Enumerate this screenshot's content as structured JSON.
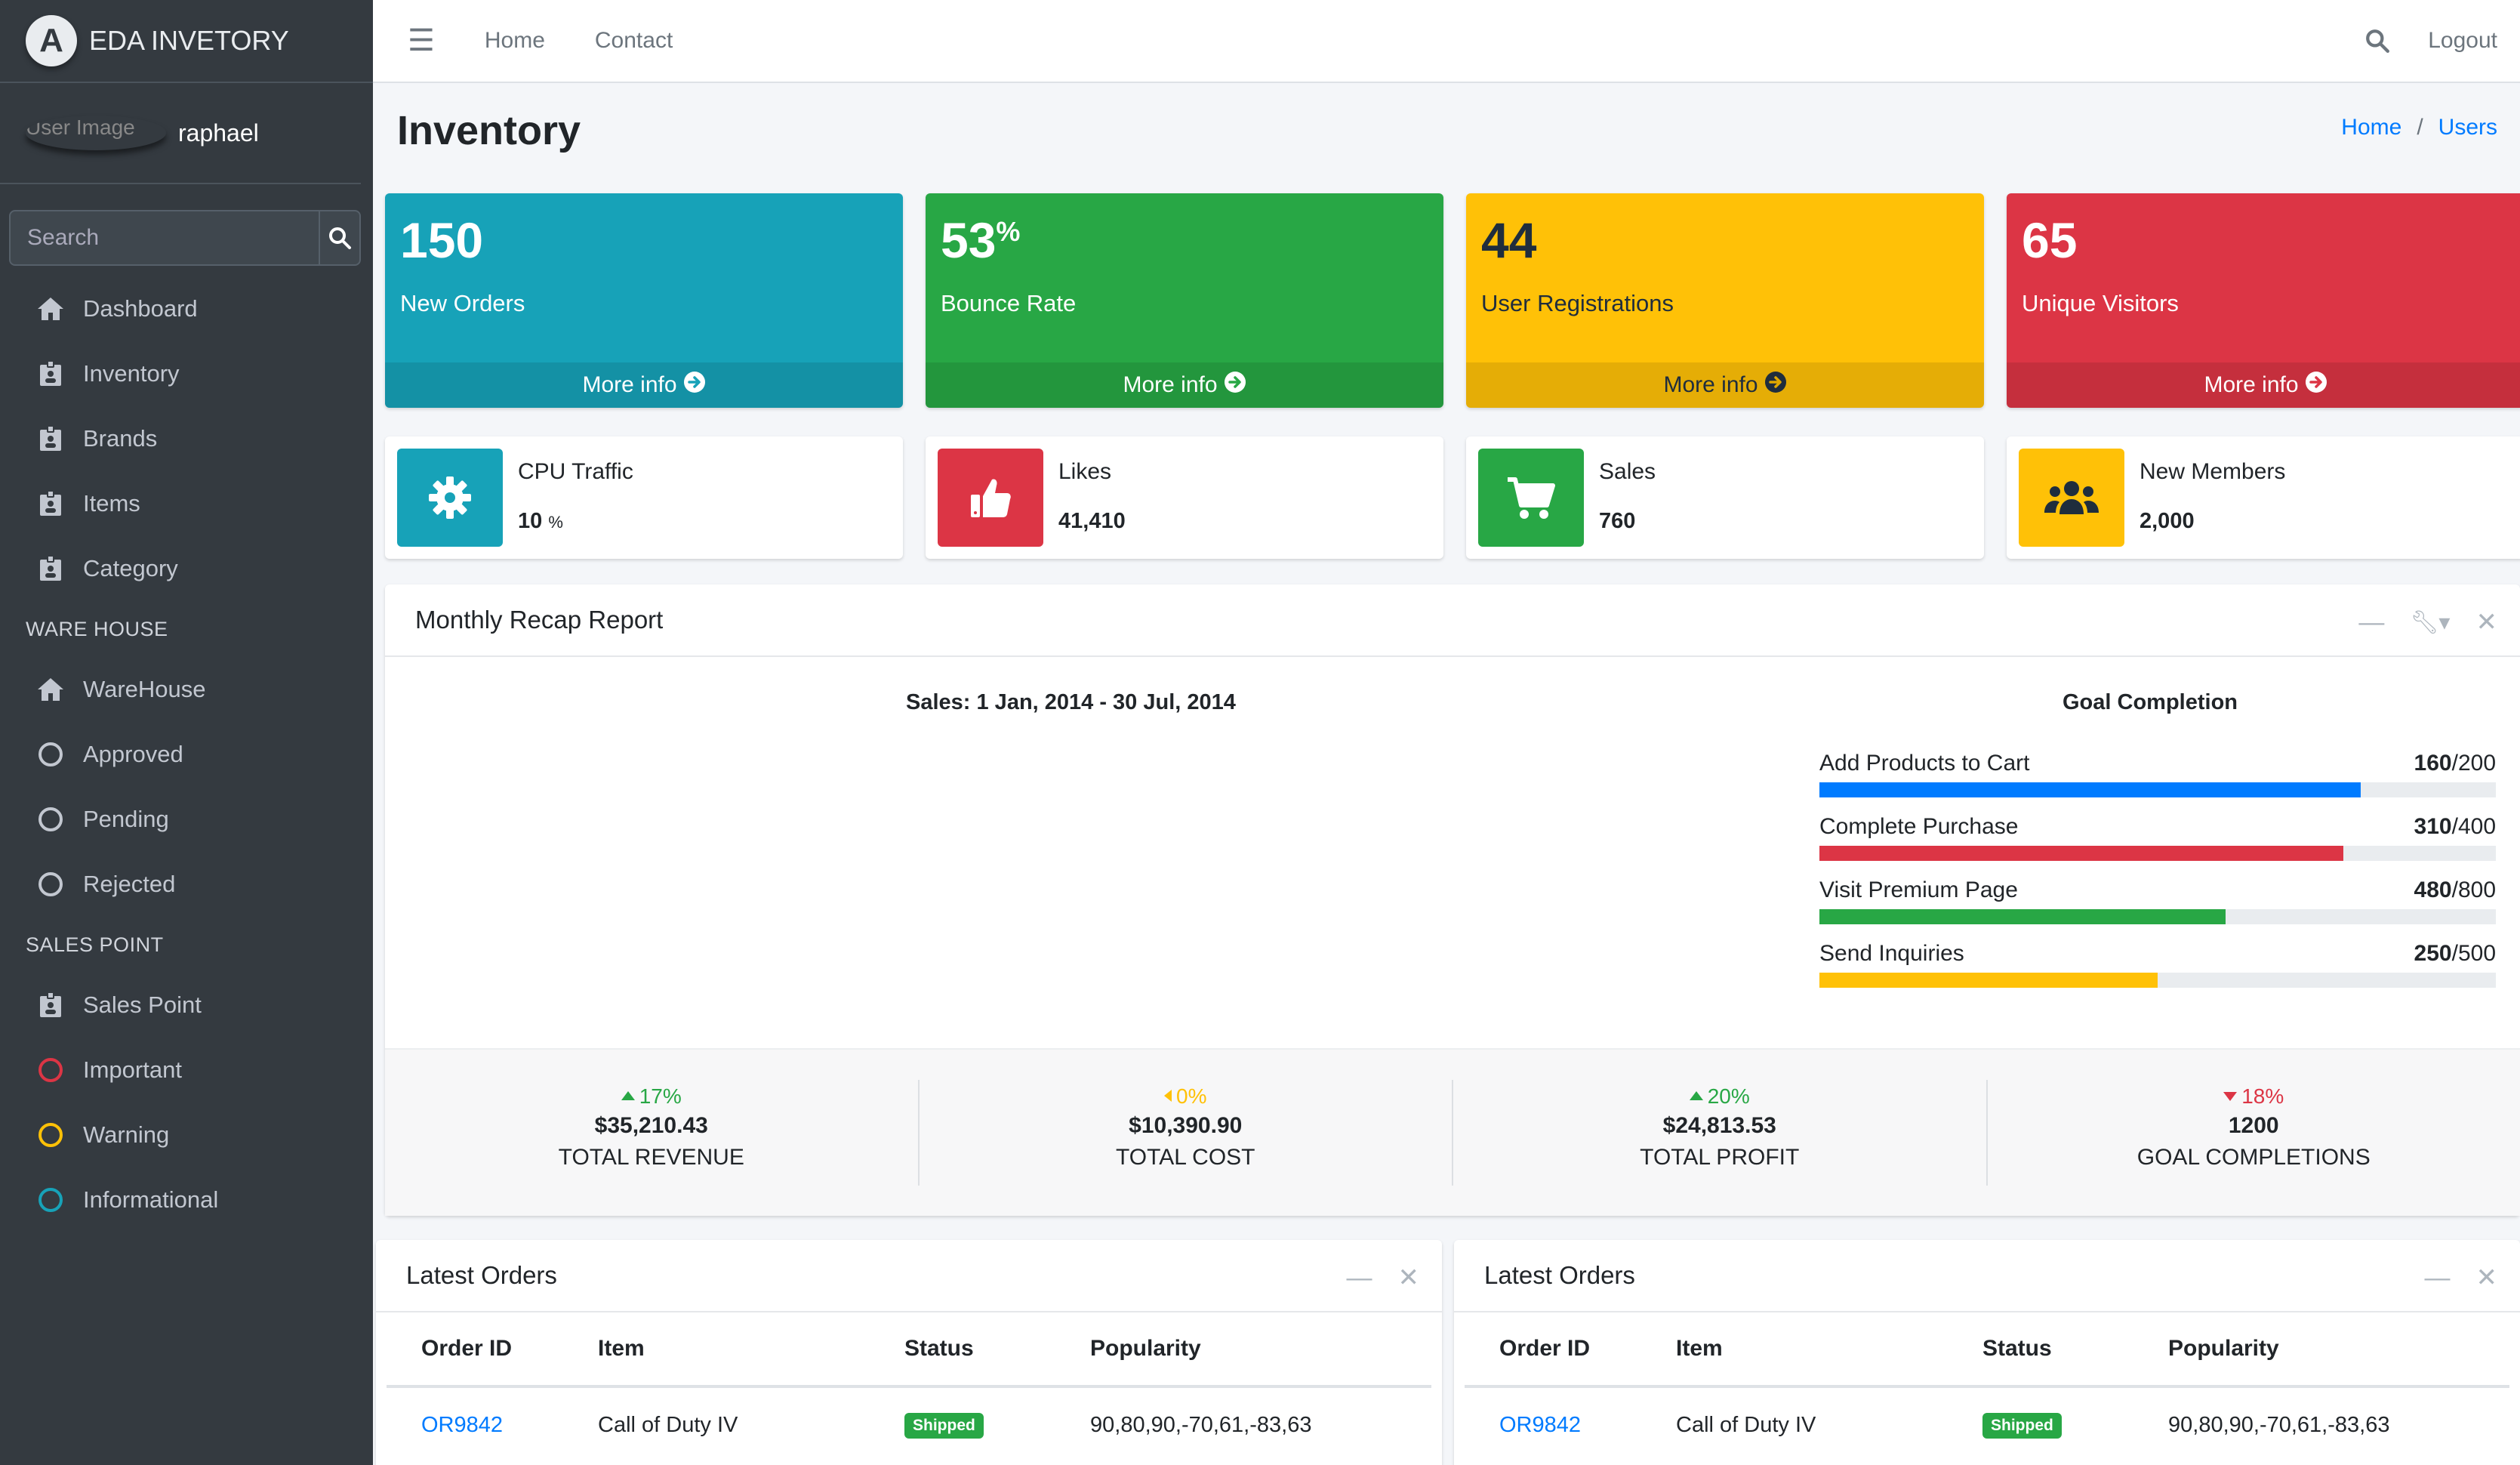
{
  "brand": {
    "name": "EDA INVETORY",
    "logo_letter": "A"
  },
  "user": {
    "image_alt": "User Image",
    "name": "raphael"
  },
  "search": {
    "placeholder": "Search"
  },
  "nav": {
    "items_main": [
      {
        "label": "Dashboard",
        "icon": "home-icon"
      },
      {
        "label": "Inventory",
        "icon": "id-badge-icon"
      },
      {
        "label": "Brands",
        "icon": "id-badge-icon"
      },
      {
        "label": "Items",
        "icon": "id-badge-icon"
      },
      {
        "label": "Category",
        "icon": "id-badge-icon"
      }
    ],
    "header_warehouse": "WARE HOUSE",
    "items_warehouse": [
      {
        "label": "WareHouse",
        "icon": "home-icon"
      },
      {
        "label": "Approved",
        "icon": "circle-icon"
      },
      {
        "label": "Pending",
        "icon": "circle-icon"
      },
      {
        "label": "Rejected",
        "icon": "circle-icon"
      }
    ],
    "header_sales": "SALES POINT",
    "items_sales": [
      {
        "label": "Sales Point",
        "icon": "id-badge-icon"
      },
      {
        "label": "Important",
        "icon": "circle-icon",
        "color": "#dc3545"
      },
      {
        "label": "Warning",
        "icon": "circle-icon",
        "color": "#ffc107"
      },
      {
        "label": "Informational",
        "icon": "circle-icon",
        "color": "#17a2b8"
      }
    ]
  },
  "topbar": {
    "home": "Home",
    "contact": "Contact",
    "logout": "Logout"
  },
  "page": {
    "title": "Inventory",
    "breadcrumb": [
      "Home",
      "Users"
    ]
  },
  "small_boxes": [
    {
      "value": "150",
      "suffix": "",
      "label": "New Orders",
      "more": "More info",
      "color": "#17a2b8"
    },
    {
      "value": "53",
      "suffix": "%",
      "label": "Bounce Rate",
      "more": "More info",
      "color": "#28a745"
    },
    {
      "value": "44",
      "suffix": "",
      "label": "User Registrations",
      "more": "More info",
      "color": "#ffc107"
    },
    {
      "value": "65",
      "suffix": "",
      "label": "Unique Visitors",
      "more": "More info",
      "color": "#dc3545"
    }
  ],
  "info_boxes": [
    {
      "title": "CPU Traffic",
      "value": "10",
      "unit": "%",
      "icon": "gear-icon",
      "color": "#17a2b8"
    },
    {
      "title": "Likes",
      "value": "41,410",
      "unit": "",
      "icon": "thumbs-up-icon",
      "color": "#dc3545"
    },
    {
      "title": "Sales",
      "value": "760",
      "unit": "",
      "icon": "shopping-cart-icon",
      "color": "#28a745"
    },
    {
      "title": "New Members",
      "value": "2,000",
      "unit": "",
      "icon": "users-icon",
      "color": "#ffc107"
    }
  ],
  "recap": {
    "title": "Monthly Recap Report",
    "sales_title": "Sales: 1 Jan, 2014 - 30 Jul, 2014",
    "goal_title": "Goal Completion",
    "goals": [
      {
        "label": "Add Products to Cart",
        "done": "160",
        "total": "/200",
        "fraction": 0.8,
        "color": "#007bff"
      },
      {
        "label": "Complete Purchase",
        "done": "310",
        "total": "/400",
        "fraction": 0.775,
        "color": "#dc3545"
      },
      {
        "label": "Visit Premium Page",
        "done": "480",
        "total": "/800",
        "fraction": 0.6,
        "color": "#28a745"
      },
      {
        "label": "Send Inquiries",
        "done": "250",
        "total": "/500",
        "fraction": 0.5,
        "color": "#ffc107"
      }
    ],
    "footer": [
      {
        "pct": "17%",
        "dir": "up",
        "color": "#28a745",
        "amount": "$35,210.43",
        "text": "TOTAL REVENUE"
      },
      {
        "pct": "0%",
        "dir": "left",
        "color": "#ffc107",
        "amount": "$10,390.90",
        "text": "TOTAL COST"
      },
      {
        "pct": "20%",
        "dir": "up",
        "color": "#28a745",
        "amount": "$24,813.53",
        "text": "TOTAL PROFIT"
      },
      {
        "pct": "18%",
        "dir": "down",
        "color": "#dc3545",
        "amount": "1200",
        "text": "GOAL COMPLETIONS"
      }
    ]
  },
  "orders": {
    "title": "Latest Orders",
    "columns": [
      "Order ID",
      "Item",
      "Status",
      "Popularity"
    ],
    "rows": [
      {
        "id": "OR9842",
        "item": "Call of Duty IV",
        "status": "Shipped",
        "popularity": "90,80,90,-70,61,-83,63"
      }
    ]
  }
}
